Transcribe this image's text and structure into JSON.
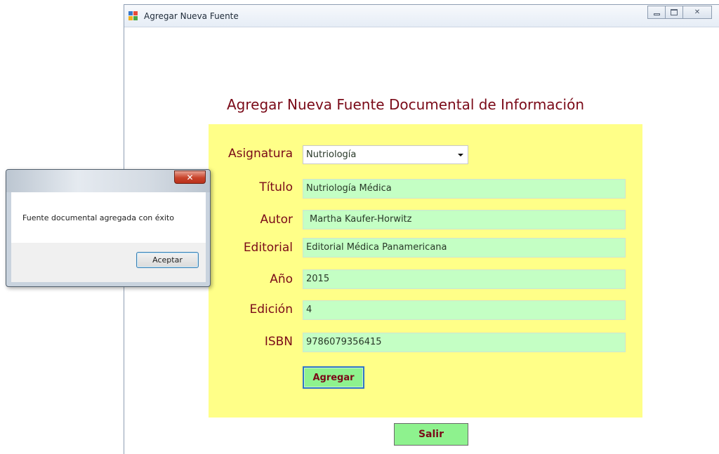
{
  "window": {
    "title": "Agregar Nueva Fuente",
    "icon": "app-icon"
  },
  "form": {
    "heading": "Agregar Nueva Fuente Documental de Información",
    "fields": [
      {
        "label": "Asignatura",
        "value": "Nutriología",
        "type": "combobox"
      },
      {
        "label": "Título",
        "value": "Nutriología Médica"
      },
      {
        "label": "Autor",
        "value": "Martha Kaufer-Horwitz"
      },
      {
        "label": "Editorial",
        "value": "Editorial Médica Panamericana"
      },
      {
        "label": "Año",
        "value": "2015"
      },
      {
        "label": "Edición",
        "value": "4"
      },
      {
        "label": "ISBN",
        "value": "9786079356415"
      }
    ],
    "add_button": "Agregar",
    "exit_button": "Salir"
  },
  "messagebox": {
    "message": "Fuente documental agregada con éxito",
    "ok_button": "Aceptar"
  },
  "colors": {
    "panel": "#ffff88",
    "input": "#c4ffc4",
    "label": "#7a0a18",
    "button": "#8ef28e"
  }
}
